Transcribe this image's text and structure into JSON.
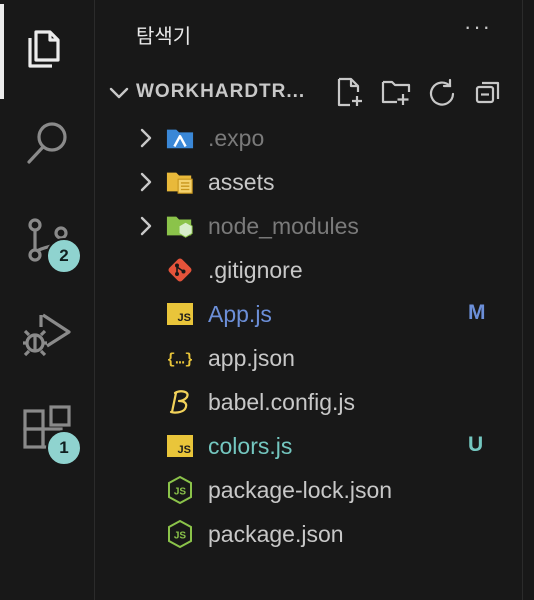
{
  "activity_bar": {
    "items": [
      {
        "name": "explorer",
        "icon": "files-icon",
        "active": true
      },
      {
        "name": "search",
        "icon": "search-icon"
      },
      {
        "name": "source-control",
        "icon": "source-control-icon",
        "badge": "2"
      },
      {
        "name": "run-debug",
        "icon": "run-debug-icon"
      },
      {
        "name": "extensions",
        "icon": "extensions-icon",
        "badge": "1"
      }
    ]
  },
  "sidebar": {
    "title": "탐색기",
    "more": "···",
    "section": {
      "title": "WORKHARDTR...",
      "actions": [
        "new-file-icon",
        "new-folder-icon",
        "refresh-icon",
        "collapse-all-icon"
      ]
    },
    "items": [
      {
        "label": ".expo",
        "type": "folder",
        "icon": "expo-folder-icon",
        "dim": true
      },
      {
        "label": "assets",
        "type": "folder",
        "icon": "assets-folder-icon"
      },
      {
        "label": "node_modules",
        "type": "folder",
        "icon": "node-modules-folder-icon",
        "dim": true
      },
      {
        "label": ".gitignore",
        "type": "file",
        "icon": "git-icon"
      },
      {
        "label": "App.js",
        "type": "file",
        "icon": "js-icon",
        "status": "M"
      },
      {
        "label": "app.json",
        "type": "file",
        "icon": "json-icon"
      },
      {
        "label": "babel.config.js",
        "type": "file",
        "icon": "babel-icon"
      },
      {
        "label": "colors.js",
        "type": "file",
        "icon": "js-icon",
        "status": "U"
      },
      {
        "label": "package-lock.json",
        "type": "file",
        "icon": "nodejs-icon"
      },
      {
        "label": "package.json",
        "type": "file",
        "icon": "nodejs-icon"
      }
    ]
  },
  "colors": {
    "text": "#c8c8c8",
    "dim": "#7a7a7a",
    "modified": "#6c8fd8",
    "untracked": "#74c7c0",
    "badge": "#8fd3cf"
  }
}
